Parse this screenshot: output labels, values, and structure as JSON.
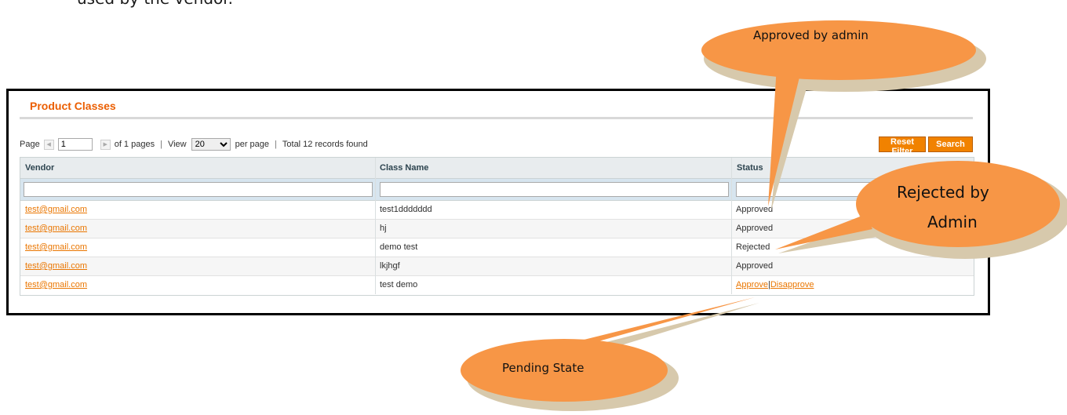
{
  "document": {
    "fragment_text": "used by the vendor."
  },
  "panel": {
    "title": "Product Classes"
  },
  "pager": {
    "page_label": "Page",
    "page_value": "1",
    "of_pages": "of 1 pages",
    "separator": "|",
    "view_label": "View",
    "per_page_value": "20",
    "per_page_label": "per page",
    "total": "Total 12 records found"
  },
  "buttons": {
    "reset_filter": "Reset Filter",
    "search": "Search"
  },
  "grid": {
    "columns": [
      "Vendor",
      "Class Name",
      "Status"
    ],
    "rows": [
      {
        "vendor": "test@gmail.com",
        "class_name": "test1ddddddd",
        "status": "Approved"
      },
      {
        "vendor": "test@gmail.com",
        "class_name": "hj",
        "status": "Approved"
      },
      {
        "vendor": "test@gmail.com",
        "class_name": "demo test",
        "status": "Rejected"
      },
      {
        "vendor": "test@gmail.com",
        "class_name": "lkjhgf",
        "status": "Approved"
      },
      {
        "vendor": "test@gmail.com",
        "class_name": "test demo",
        "actions": {
          "approve": "Approve",
          "separator": "|",
          "disapprove": "Disapprove"
        }
      }
    ]
  },
  "callouts": {
    "approved": "Approved by admin",
    "rejected_line1": "Rejected by",
    "rejected_line2": "Admin",
    "pending": "Pending State"
  },
  "colors": {
    "accent_orange": "#f18200",
    "link_orange": "#ea7601",
    "callout_fill": "#f79646",
    "callout_edge": "#d7c9ac"
  }
}
